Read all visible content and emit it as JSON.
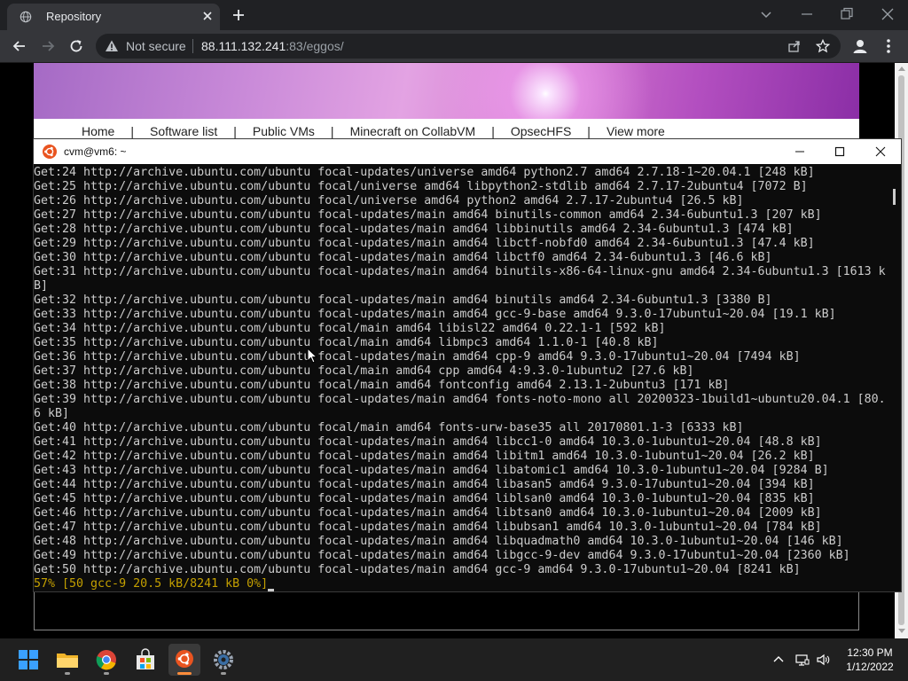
{
  "browser": {
    "tab_title": "Repository",
    "security_label": "Not secure",
    "url_host": "88.111.132.241",
    "url_rest": ":83/eggos/"
  },
  "site": {
    "nav_items": [
      "Home",
      "Software list",
      "Public VMs",
      "Minecraft on CollabVM",
      "OpsecHFS",
      "View more"
    ],
    "nav_separator": "|"
  },
  "terminal": {
    "title": "cvm@vm6: ~",
    "lines": [
      "Get:24 http://archive.ubuntu.com/ubuntu focal-updates/universe amd64 python2.7 amd64 2.7.18-1~20.04.1 [248 kB]",
      "Get:25 http://archive.ubuntu.com/ubuntu focal/universe amd64 libpython2-stdlib amd64 2.7.17-2ubuntu4 [7072 B]",
      "Get:26 http://archive.ubuntu.com/ubuntu focal/universe amd64 python2 amd64 2.7.17-2ubuntu4 [26.5 kB]",
      "Get:27 http://archive.ubuntu.com/ubuntu focal-updates/main amd64 binutils-common amd64 2.34-6ubuntu1.3 [207 kB]",
      "Get:28 http://archive.ubuntu.com/ubuntu focal-updates/main amd64 libbinutils amd64 2.34-6ubuntu1.3 [474 kB]",
      "Get:29 http://archive.ubuntu.com/ubuntu focal-updates/main amd64 libctf-nobfd0 amd64 2.34-6ubuntu1.3 [47.4 kB]",
      "Get:30 http://archive.ubuntu.com/ubuntu focal-updates/main amd64 libctf0 amd64 2.34-6ubuntu1.3 [46.6 kB]",
      "Get:31 http://archive.ubuntu.com/ubuntu focal-updates/main amd64 binutils-x86-64-linux-gnu amd64 2.34-6ubuntu1.3 [1613 k",
      "B]",
      "Get:32 http://archive.ubuntu.com/ubuntu focal-updates/main amd64 binutils amd64 2.34-6ubuntu1.3 [3380 B]",
      "Get:33 http://archive.ubuntu.com/ubuntu focal-updates/main amd64 gcc-9-base amd64 9.3.0-17ubuntu1~20.04 [19.1 kB]",
      "Get:34 http://archive.ubuntu.com/ubuntu focal/main amd64 libisl22 amd64 0.22.1-1 [592 kB]",
      "Get:35 http://archive.ubuntu.com/ubuntu focal/main amd64 libmpc3 amd64 1.1.0-1 [40.8 kB]",
      "Get:36 http://archive.ubuntu.com/ubuntu focal-updates/main amd64 cpp-9 amd64 9.3.0-17ubuntu1~20.04 [7494 kB]",
      "Get:37 http://archive.ubuntu.com/ubuntu focal/main amd64 cpp amd64 4:9.3.0-1ubuntu2 [27.6 kB]",
      "Get:38 http://archive.ubuntu.com/ubuntu focal/main amd64 fontconfig amd64 2.13.1-2ubuntu3 [171 kB]",
      "Get:39 http://archive.ubuntu.com/ubuntu focal-updates/main amd64 fonts-noto-mono all 20200323-1build1~ubuntu20.04.1 [80.",
      "6 kB]",
      "Get:40 http://archive.ubuntu.com/ubuntu focal/main amd64 fonts-urw-base35 all 20170801.1-3 [6333 kB]",
      "Get:41 http://archive.ubuntu.com/ubuntu focal-updates/main amd64 libcc1-0 amd64 10.3.0-1ubuntu1~20.04 [48.8 kB]",
      "Get:42 http://archive.ubuntu.com/ubuntu focal-updates/main amd64 libitm1 amd64 10.3.0-1ubuntu1~20.04 [26.2 kB]",
      "Get:43 http://archive.ubuntu.com/ubuntu focal-updates/main amd64 libatomic1 amd64 10.3.0-1ubuntu1~20.04 [9284 B]",
      "Get:44 http://archive.ubuntu.com/ubuntu focal-updates/main amd64 libasan5 amd64 9.3.0-17ubuntu1~20.04 [394 kB]",
      "Get:45 http://archive.ubuntu.com/ubuntu focal-updates/main amd64 liblsan0 amd64 10.3.0-1ubuntu1~20.04 [835 kB]",
      "Get:46 http://archive.ubuntu.com/ubuntu focal-updates/main amd64 libtsan0 amd64 10.3.0-1ubuntu1~20.04 [2009 kB]",
      "Get:47 http://archive.ubuntu.com/ubuntu focal-updates/main amd64 libubsan1 amd64 10.3.0-1ubuntu1~20.04 [784 kB]",
      "Get:48 http://archive.ubuntu.com/ubuntu focal-updates/main amd64 libquadmath0 amd64 10.3.0-1ubuntu1~20.04 [146 kB]",
      "Get:49 http://archive.ubuntu.com/ubuntu focal-updates/main amd64 libgcc-9-dev amd64 9.3.0-17ubuntu1~20.04 [2360 kB]",
      "Get:50 http://archive.ubuntu.com/ubuntu focal-updates/main amd64 gcc-9 amd64 9.3.0-17ubuntu1~20.04 [8241 kB]"
    ],
    "progress_line": "57% [50 gcc-9 20.5 kB/8241 kB 0%]"
  },
  "taskbar": {
    "apps": [
      "windows-start-icon",
      "file-explorer-icon",
      "chrome-icon",
      "microsoft-store-icon",
      "ubuntu-icon",
      "settings-icon"
    ],
    "active_app": "ubuntu-icon",
    "time": "12:30 PM",
    "date": "1/12/2022"
  },
  "colors": {
    "terminal_bg": "#0c0c0c",
    "terminal_text": "#cccccc",
    "progress_text": "#c4a000",
    "ubuntu_orange": "#e95420"
  }
}
